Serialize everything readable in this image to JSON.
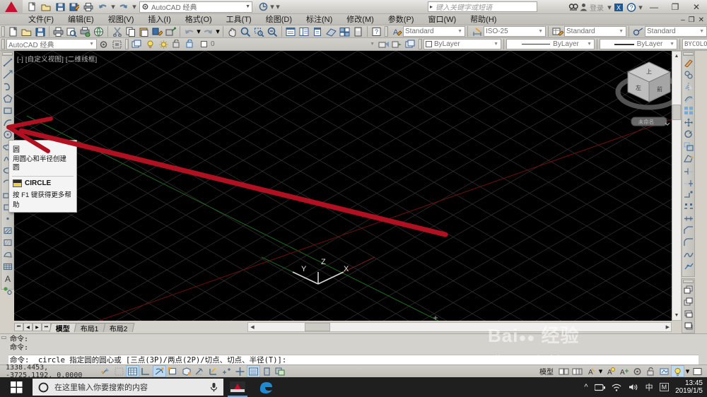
{
  "titlebar": {
    "workspace": "AutoCAD 经典",
    "search_placeholder": "键入关键字或短语",
    "signin": "登录",
    "minimize": "—",
    "restore": "❐",
    "close": "✕",
    "quick_access": [
      "new-icon",
      "open-icon",
      "save-icon",
      "saveas-icon",
      "plot-icon",
      "undo-icon",
      "redo-icon"
    ]
  },
  "menubar": {
    "items": [
      {
        "label": "文件(F)",
        "name": "menu-file"
      },
      {
        "label": "编辑(E)",
        "name": "menu-edit"
      },
      {
        "label": "视图(V)",
        "name": "menu-view"
      },
      {
        "label": "插入(I)",
        "name": "menu-insert"
      },
      {
        "label": "格式(O)",
        "name": "menu-format"
      },
      {
        "label": "工具(T)",
        "name": "menu-tools"
      },
      {
        "label": "绘图(D)",
        "name": "menu-draw"
      },
      {
        "label": "标注(N)",
        "name": "menu-dimension"
      },
      {
        "label": "修改(M)",
        "name": "menu-modify"
      },
      {
        "label": "参数(P)",
        "name": "menu-parametric"
      },
      {
        "label": "窗口(W)",
        "name": "menu-window"
      },
      {
        "label": "帮助(H)",
        "name": "menu-help"
      }
    ],
    "doc_minimize": "–",
    "doc_restore": "❐",
    "doc_close": "✕"
  },
  "toolbar_row1": {
    "workspace_value": "AutoCAD 经典",
    "text_style": "Standard",
    "dim_style": "ISO-25",
    "table_style": "Standard",
    "mleader_style": "Standard"
  },
  "toolbar_row2": {
    "layer_value": "0",
    "color_value": "ByLayer",
    "linetype_value": "ByLayer",
    "lineweight_value": "ByLayer",
    "plotstyle_value": "BYCOLOR"
  },
  "canvas": {
    "viewport_label": "[-] [自定义视图] [二维线框]",
    "ucs": {
      "x": "X",
      "y": "Y",
      "z": "Z"
    },
    "viewcube": {
      "top": "上",
      "left": "左",
      "front": "前",
      "ucs_label": "未命名"
    },
    "background_color": "#000000",
    "grid_color": "#3a3a3a",
    "annotation_color": "#b01020"
  },
  "tooltip": {
    "title": "圆",
    "description": "用圆心和半径创建圆",
    "command": "CIRCLE",
    "help": "按 F1 键获得更多帮助"
  },
  "model_tabs": {
    "tabs": [
      {
        "label": "模型",
        "active": true
      },
      {
        "label": "布局1",
        "active": false
      },
      {
        "label": "布局2",
        "active": false
      }
    ],
    "nav": [
      "⏮",
      "◀",
      "▶",
      "⏭"
    ]
  },
  "command_line": {
    "history": [
      "命令:",
      "命令:"
    ],
    "current": "命令: _circle 指定圆的圆心或 [三点(3P)/两点(2P)/切点、切点、半径(T)]:"
  },
  "statusbar": {
    "coordinates": "1338.4453,  -3725.1192,  0.0000",
    "model_label": "模型",
    "toggles": [
      {
        "name": "snap-mode-toggle",
        "on": false
      },
      {
        "name": "grid-display-toggle",
        "on": false
      },
      {
        "name": "grid-mode-toggle",
        "on": true
      },
      {
        "name": "ortho-mode-toggle",
        "on": false
      },
      {
        "name": "polar-tracking-toggle",
        "on": true
      },
      {
        "name": "object-snap-toggle",
        "on": false
      },
      {
        "name": "3d-object-snap-toggle",
        "on": false
      },
      {
        "name": "object-snap-tracking-toggle",
        "on": false
      },
      {
        "name": "allow-ucs-toggle",
        "on": false
      },
      {
        "name": "dynamic-ucs-toggle",
        "on": false
      },
      {
        "name": "dynamic-input-toggle",
        "on": false
      },
      {
        "name": "lineweight-toggle",
        "on": true
      },
      {
        "name": "transparency-toggle",
        "on": false
      },
      {
        "name": "selection-cycling-toggle",
        "on": false
      }
    ]
  },
  "watermark": {
    "main": "Bai",
    "main2": "经验",
    "url": "jingyan.baidu.com"
  },
  "taskbar": {
    "search_placeholder": "在这里输入你要搜索的内容",
    "apps": [
      "autocad-app-icon",
      "edge-app-icon"
    ],
    "tray_icons": [
      "chevron-up-icon",
      "battery-icon",
      "wifi-icon",
      "volume-icon"
    ],
    "ime": "中",
    "ime2": "M",
    "time": "13:45",
    "date": "2019/1/5"
  }
}
